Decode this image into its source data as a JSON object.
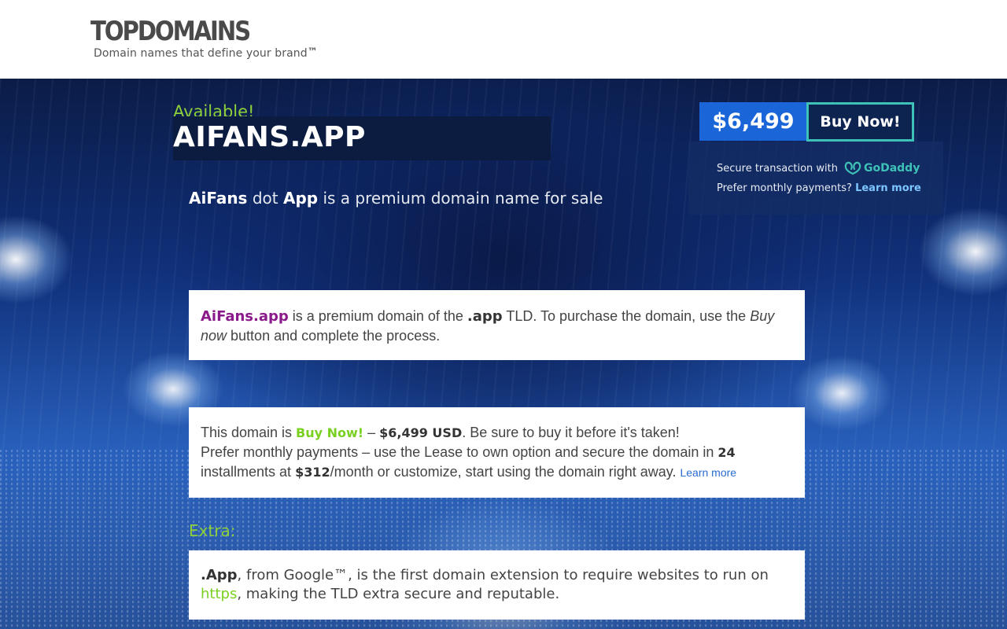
{
  "header": {
    "logo_text": "TOPDOMAINS",
    "tagline": "Domain names that define your brand",
    "tagline_mark": "™"
  },
  "hero": {
    "available_label": "Available!",
    "domain_title": "AIFANS.APP",
    "subhead": {
      "part1": "AiFans",
      "part2": " dot ",
      "part3": "App",
      "part4": " is a premium domain name for sale"
    }
  },
  "purchase": {
    "price": "$6,499",
    "buy_label": "Buy Now!",
    "secure_text": "Secure transaction with",
    "godaddy_label": "GoDaddy",
    "monthly_text": "Prefer monthly payments?",
    "learn_more": "Learn more"
  },
  "card1": {
    "brand": "AiFans.app",
    "text1": " is a premium domain of the ",
    "tld": ".app",
    "text2": " TLD. To purchase the domain, use the ",
    "buy_now_italic": "Buy now",
    "text3": " button and complete the process."
  },
  "card2": {
    "text1": "This domain is ",
    "status": "Buy Now!",
    "text2": " – ",
    "price_usd": "$6,499 USD",
    "text3": ". Be sure to buy it before it's taken!",
    "text4": "Prefer monthly payments – use the Lease to own option and secure the domain in ",
    "installments": "24",
    "text5": " installments at ",
    "monthly_price": "$312",
    "text6": "/month or customize, start using the domain right away. ",
    "learn_more": "Learn more"
  },
  "extra": {
    "heading": "Extra:",
    "tld": ".App",
    "text1": ", from Google™, is the first domain extension to require websites to run on ",
    "https": "https",
    "text2": ", making the TLD extra secure and reputable."
  },
  "colors": {
    "accent_green": "#8ed03a",
    "price_blue": "#1a66d8",
    "button_border": "#3ec1b7",
    "brand_purple": "#8a1a8a"
  }
}
